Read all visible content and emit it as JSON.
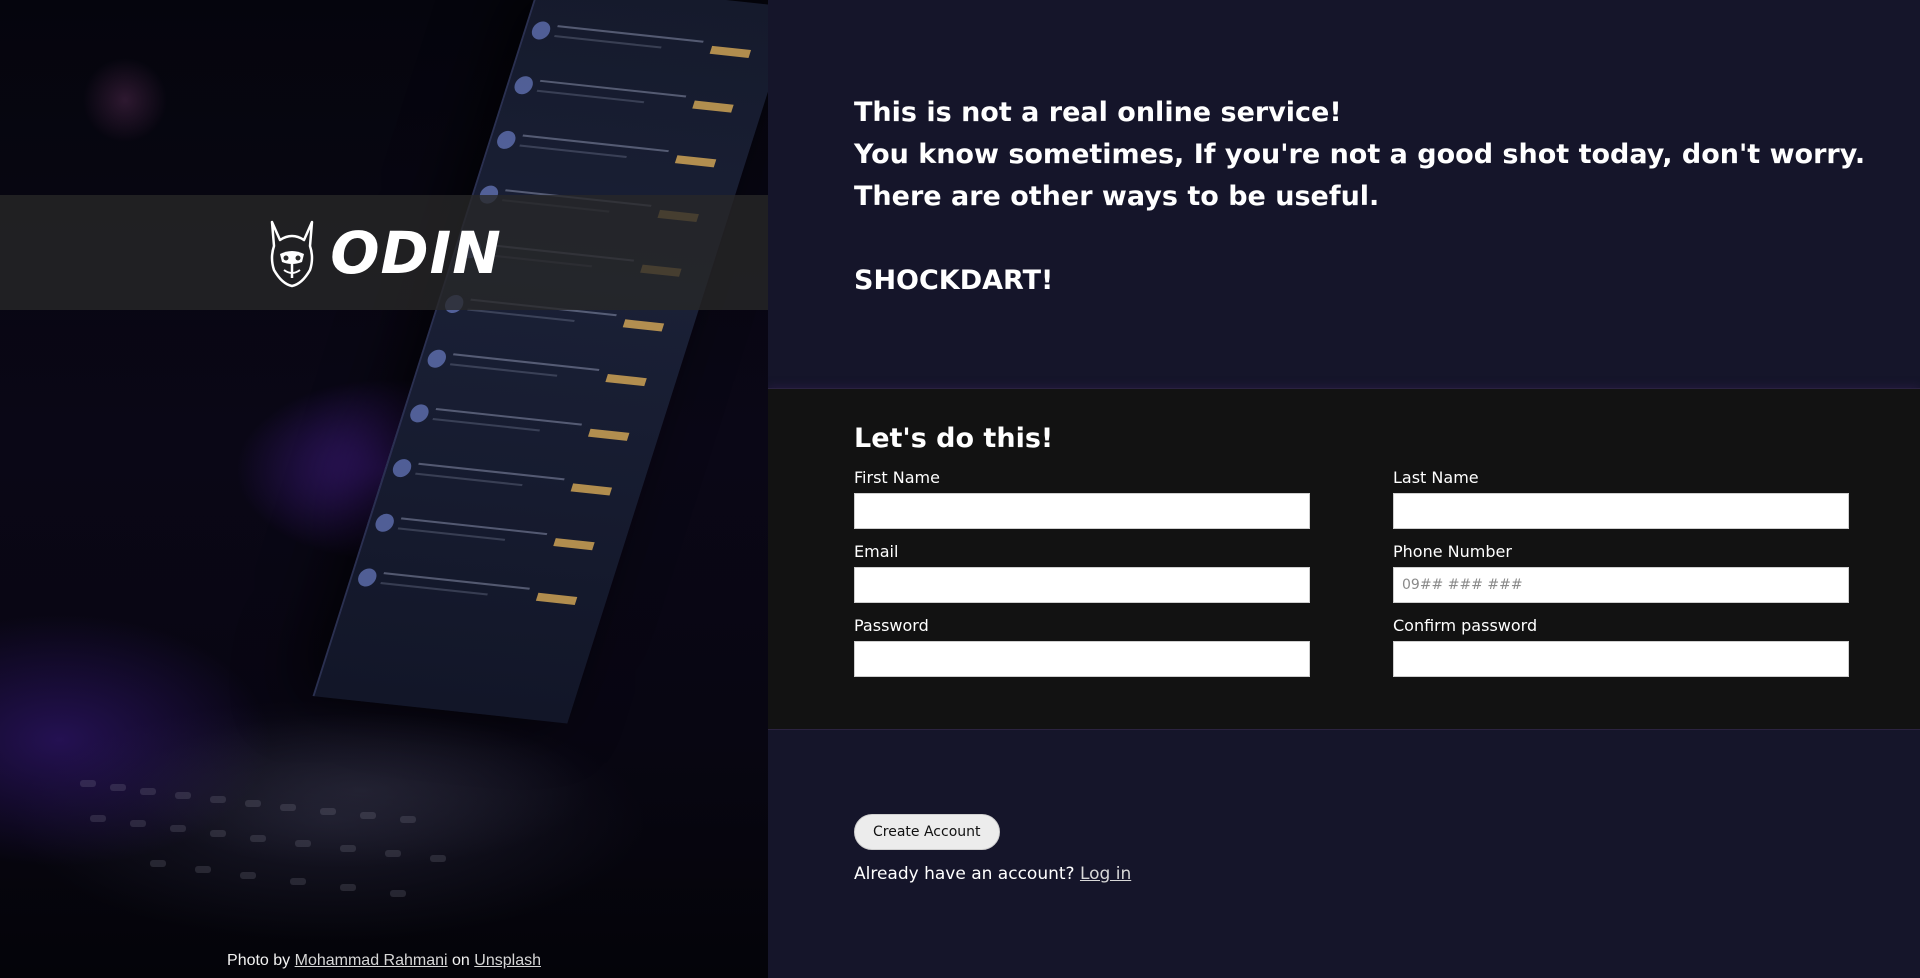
{
  "hero": {
    "logo_text": "ODIN",
    "logo_icon": "odin-helmet-icon",
    "credit": {
      "prefix": "Photo by",
      "author": "Mohammad Rahmani",
      "middle": "on",
      "source": "Unsplash"
    }
  },
  "intro": {
    "line1": "This is not a real online service!",
    "line2": "You know sometimes, If you're not a good shot today, don't worry.",
    "line3": "There are other ways to be useful.",
    "brand": "SHOCKDART!"
  },
  "form": {
    "title": "Let's do this!",
    "fields": {
      "first_name": {
        "label": "First Name",
        "value": "",
        "placeholder": ""
      },
      "last_name": {
        "label": "Last Name",
        "value": "",
        "placeholder": ""
      },
      "email": {
        "label": "Email",
        "value": "",
        "placeholder": ""
      },
      "phone": {
        "label": "Phone Number",
        "value": "",
        "placeholder": "09## ### ###"
      },
      "password": {
        "label": "Password",
        "value": "",
        "placeholder": ""
      },
      "confirm_password": {
        "label": "Confirm password",
        "value": "",
        "placeholder": ""
      }
    }
  },
  "actions": {
    "create_label": "Create Account",
    "login_prompt": "Already have an account?",
    "login_link": "Log in"
  },
  "colors": {
    "page_bg": "#15152a",
    "form_bg": "#121212",
    "text": "#ffffff"
  }
}
